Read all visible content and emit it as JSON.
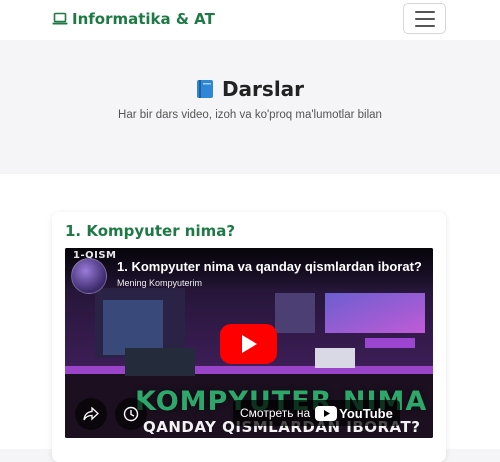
{
  "navbar": {
    "brand": "Informatika & AT",
    "brand_icon": "laptop-icon",
    "menu_icon": "hamburger-icon"
  },
  "hero": {
    "title": "Darslar",
    "title_icon": "book-icon",
    "subtitle": "Har bir dars video, izoh va ko'proq ma'lumotlar bilan"
  },
  "lessons": [
    {
      "title": "1. Kompyuter nima?",
      "video": {
        "tag": "1-QISM",
        "title": "1. Kompyuter nima va qanday qismlardan iborat?",
        "channel": "Mening Kompyuterim",
        "overlay_text": "KOMPYUTER NIMA",
        "overlay_sub": "QANDAY QISMLARDAN IBORAT?",
        "watch_on": "Смотреть на",
        "platform": "YouTube"
      }
    }
  ],
  "colors": {
    "brand": "#1e7a45",
    "youtube_red": "#ff0000"
  }
}
